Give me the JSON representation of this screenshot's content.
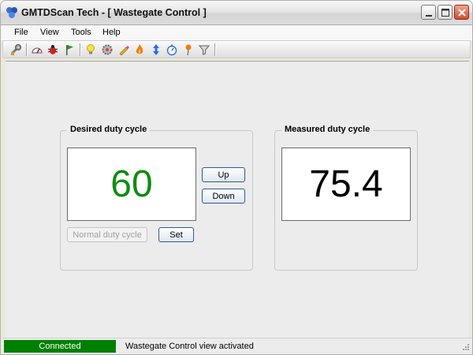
{
  "window": {
    "title": "GMTDScan Tech - [ Wastegate Control ]"
  },
  "menu": {
    "items": [
      "File",
      "View",
      "Tools",
      "Help"
    ]
  },
  "toolbar": {
    "icons": [
      "wrench-icon",
      "gauge-icon",
      "bug-icon",
      "flag-icon",
      "bulb-icon",
      "cog-icon",
      "pencil-icon",
      "flame-icon",
      "updown-arrow-icon",
      "stopwatch-icon",
      "pin-icon",
      "filter-icon"
    ]
  },
  "desired": {
    "title": "Desired duty cycle",
    "value": "60",
    "up_label": "Up",
    "down_label": "Down",
    "normal_label": "Normal duty cycle",
    "set_label": "Set",
    "value_color": "#118c11"
  },
  "measured": {
    "title": "Measured duty cycle",
    "value": "75.4"
  },
  "status": {
    "connection": "Connected",
    "message": "Wastegate Control view activated",
    "connection_color": "#008000"
  }
}
